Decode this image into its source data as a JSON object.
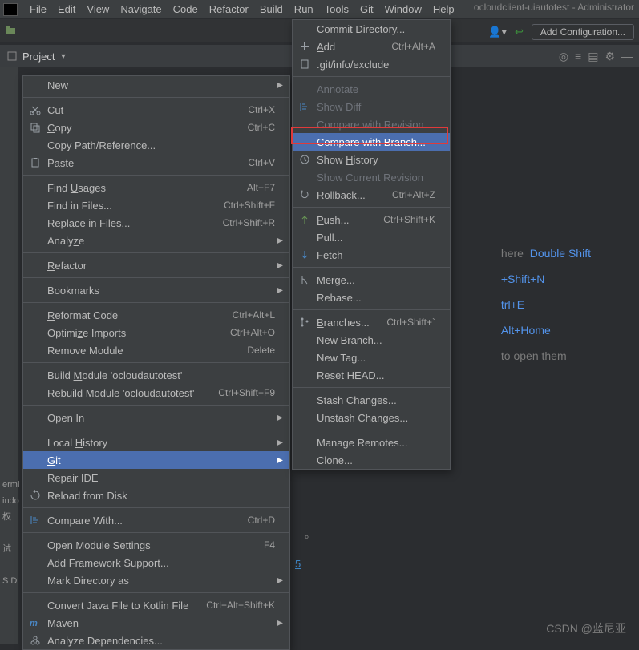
{
  "window": {
    "title_tail": "ocloudclient-uiautotest - Administrator"
  },
  "menubar": [
    "File",
    "Edit",
    "View",
    "Navigate",
    "Code",
    "Refactor",
    "Build",
    "Run",
    "Tools",
    "Git",
    "Window",
    "Help"
  ],
  "toolbar": {
    "add_config": "Add Configuration..."
  },
  "project_panel": {
    "label": "Project"
  },
  "hints": {
    "l1a": "here",
    "l1b": "Double Shift",
    "l2": "+Shift+N",
    "l3": "trl+E",
    "l4": "Alt+Home",
    "l5": "to open them"
  },
  "side_cjk": {
    "a": "权",
    "b": "试",
    "c": "S D",
    "d": "。",
    "e": "indo",
    "f": "ermi"
  },
  "watermark": "CSDN @蓝尼亚",
  "ctx1": [
    {
      "t": "sub",
      "label": "New"
    },
    {
      "t": "sep"
    },
    {
      "t": "item",
      "icon": "cut-icon",
      "label": "Cut",
      "u": "t",
      "sc": "Ctrl+X"
    },
    {
      "t": "item",
      "icon": "copy-icon",
      "label": "Copy",
      "u": "C",
      "sc": "Ctrl+C"
    },
    {
      "t": "item",
      "label": "Copy Path/Reference..."
    },
    {
      "t": "item",
      "icon": "paste-icon",
      "label": "Paste",
      "u": "P",
      "sc": "Ctrl+V"
    },
    {
      "t": "sep"
    },
    {
      "t": "item",
      "label": "Find Usages",
      "u": "U",
      "sc": "Alt+F7"
    },
    {
      "t": "item",
      "label": "Find in Files...",
      "sc": "Ctrl+Shift+F"
    },
    {
      "t": "item",
      "label": "Replace in Files...",
      "u": "R",
      "sc": "Ctrl+Shift+R"
    },
    {
      "t": "sub",
      "label": "Analyze",
      "u": "z"
    },
    {
      "t": "sep"
    },
    {
      "t": "sub",
      "label": "Refactor",
      "u": "R"
    },
    {
      "t": "sep"
    },
    {
      "t": "sub",
      "label": "Bookmarks"
    },
    {
      "t": "sep"
    },
    {
      "t": "item",
      "label": "Reformat Code",
      "u": "R",
      "sc": "Ctrl+Alt+L"
    },
    {
      "t": "item",
      "label": "Optimize Imports",
      "u": "z",
      "sc": "Ctrl+Alt+O"
    },
    {
      "t": "item",
      "label": "Remove Module",
      "sc": "Delete"
    },
    {
      "t": "sep"
    },
    {
      "t": "item",
      "label": "Build Module 'ocloudautotest'",
      "u": "M"
    },
    {
      "t": "item",
      "label": "Rebuild Module 'ocloudautotest'",
      "u": "e",
      "sc": "Ctrl+Shift+F9"
    },
    {
      "t": "sep"
    },
    {
      "t": "sub",
      "label": "Open In"
    },
    {
      "t": "sep"
    },
    {
      "t": "sub",
      "label": "Local History",
      "u": "H"
    },
    {
      "t": "sub",
      "label": "Git",
      "u": "G",
      "sel": true
    },
    {
      "t": "item",
      "label": "Repair IDE"
    },
    {
      "t": "item",
      "icon": "reload-icon",
      "label": "Reload from Disk"
    },
    {
      "t": "sep"
    },
    {
      "t": "item",
      "icon": "diff-icon",
      "label": "Compare With...",
      "sc": "Ctrl+D"
    },
    {
      "t": "sep"
    },
    {
      "t": "item",
      "label": "Open Module Settings",
      "sc": "F4"
    },
    {
      "t": "item",
      "label": "Add Framework Support..."
    },
    {
      "t": "sub",
      "label": "Mark Directory as"
    },
    {
      "t": "sep"
    },
    {
      "t": "item",
      "label": "Convert Java File to Kotlin File",
      "sc": "Ctrl+Alt+Shift+K"
    },
    {
      "t": "sub",
      "icon": "maven-icon",
      "label": "Maven"
    },
    {
      "t": "item",
      "icon": "deps-icon",
      "label": "Analyze Dependencies..."
    }
  ],
  "ctx2": [
    {
      "t": "item",
      "label": "Commit Directory..."
    },
    {
      "t": "item",
      "icon": "plus-icon",
      "label": "Add",
      "u": "A",
      "sc": "Ctrl+Alt+A"
    },
    {
      "t": "item",
      "icon": "file-icon",
      "label": ".git/info/exclude"
    },
    {
      "t": "sep"
    },
    {
      "t": "item",
      "label": "Annotate",
      "disabled": true
    },
    {
      "t": "item",
      "icon": "diff-icon",
      "label": "Show Diff",
      "disabled": true
    },
    {
      "t": "item",
      "label": "Compare with Revision...",
      "disabled": true
    },
    {
      "t": "item",
      "label": "Compare with Branch...",
      "sel": true
    },
    {
      "t": "item",
      "icon": "history-icon",
      "label": "Show History",
      "u": "H"
    },
    {
      "t": "item",
      "label": "Show Current Revision",
      "disabled": true
    },
    {
      "t": "item",
      "icon": "rollback-icon",
      "label": "Rollback...",
      "u": "R",
      "sc": "Ctrl+Alt+Z"
    },
    {
      "t": "sep"
    },
    {
      "t": "item",
      "icon": "push-icon",
      "label": "Push...",
      "u": "P",
      "sc": "Ctrl+Shift+K"
    },
    {
      "t": "item",
      "label": "Pull..."
    },
    {
      "t": "item",
      "icon": "fetch-icon",
      "label": "Fetch"
    },
    {
      "t": "sep"
    },
    {
      "t": "item",
      "icon": "merge-icon",
      "label": "Merge..."
    },
    {
      "t": "item",
      "label": "Rebase..."
    },
    {
      "t": "sep"
    },
    {
      "t": "item",
      "icon": "branch-icon",
      "label": "Branches...",
      "u": "B",
      "sc": "Ctrl+Shift+`"
    },
    {
      "t": "item",
      "label": "New Branch..."
    },
    {
      "t": "item",
      "label": "New Tag..."
    },
    {
      "t": "item",
      "label": "Reset HEAD..."
    },
    {
      "t": "sep"
    },
    {
      "t": "item",
      "label": "Stash Changes..."
    },
    {
      "t": "item",
      "label": "Unstash Changes..."
    },
    {
      "t": "sep"
    },
    {
      "t": "item",
      "label": "Manage Remotes..."
    },
    {
      "t": "item",
      "label": "Clone..."
    }
  ]
}
